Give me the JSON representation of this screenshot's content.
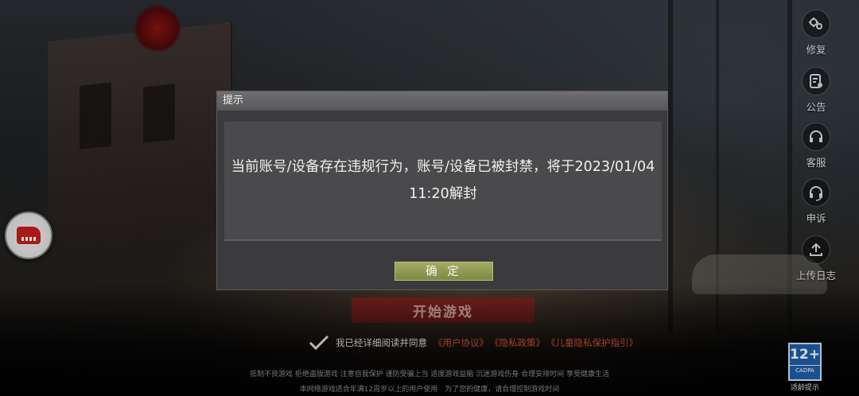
{
  "toolbar": {
    "items": [
      {
        "label": "修复",
        "icon": "repair-gear-icon"
      },
      {
        "label": "公告",
        "icon": "announcement-icon"
      },
      {
        "label": "客服",
        "icon": "customer-service-headset-icon"
      },
      {
        "label": "申诉",
        "icon": "appeal-headset-icon"
      },
      {
        "label": "上传日志",
        "icon": "upload-log-icon"
      }
    ]
  },
  "main": {
    "start_button": "开始游戏",
    "agreement": {
      "text": "我已经详细阅读并同意",
      "links": [
        "《用户协议》",
        "《隐私政策》",
        "《儿童隐私保护指引》"
      ]
    },
    "notice_line1": "抵制不良游戏 拒绝盗版游戏 注意自我保护 谨防受骗上当 适度游戏益脑 沉迷游戏伤身 合理安排时间 享受健康生活",
    "notice_line2": "本网络游戏适合年满12周岁以上的用户使用　为了您的健康，请合理控制游戏时间"
  },
  "age_rating": {
    "number": "12+",
    "tag": "CADPA",
    "label": "适龄提示"
  },
  "dialog": {
    "title": "提示",
    "message": "当前账号/设备存在违规行为，账号/设备已被封禁，将于2023/01/04 11:20解封",
    "confirm": "确 定"
  },
  "colors": {
    "dialog_bg": "#3b3b3d",
    "confirm_button": "#8f9952",
    "start_button": "#8c1e1c",
    "link": "#c24a2e",
    "age_badge": "#1f5fa8"
  }
}
